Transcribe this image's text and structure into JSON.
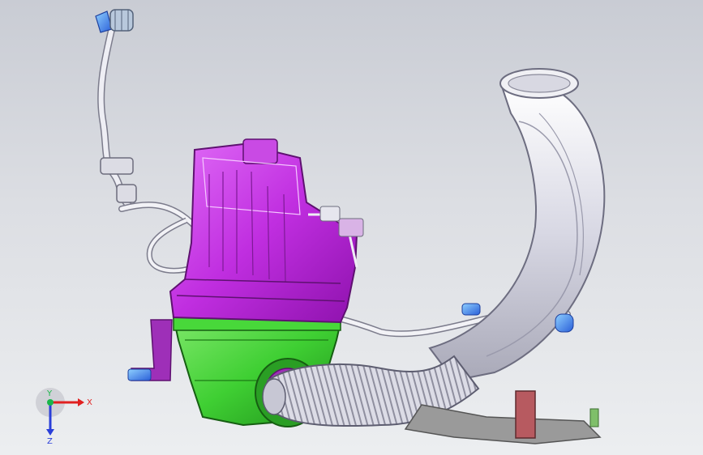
{
  "triad": {
    "x_label": "X",
    "y_label": "Y",
    "z_label": "Z",
    "x_color": "#e02020",
    "y_color": "#19b64a",
    "z_color": "#2a3fd9"
  },
  "colors": {
    "background_top": "#c9ccd4",
    "background_bottom": "#eceef0",
    "upper_housing": "#c72ee6",
    "lower_housing": "#3fcf33",
    "hoses": "#e6e6ee",
    "connector_blue": "#3c7ef0",
    "bracket_gray": "#8a8a8a",
    "bracket_dark": "#b75a60"
  },
  "parts": [
    "air-filter-upper-housing-icon",
    "air-filter-lower-housing-icon",
    "intake-duct-icon",
    "corrugated-hose-icon",
    "breather-hose-icon",
    "blue-connector-icon",
    "mounting-bracket-icon"
  ]
}
